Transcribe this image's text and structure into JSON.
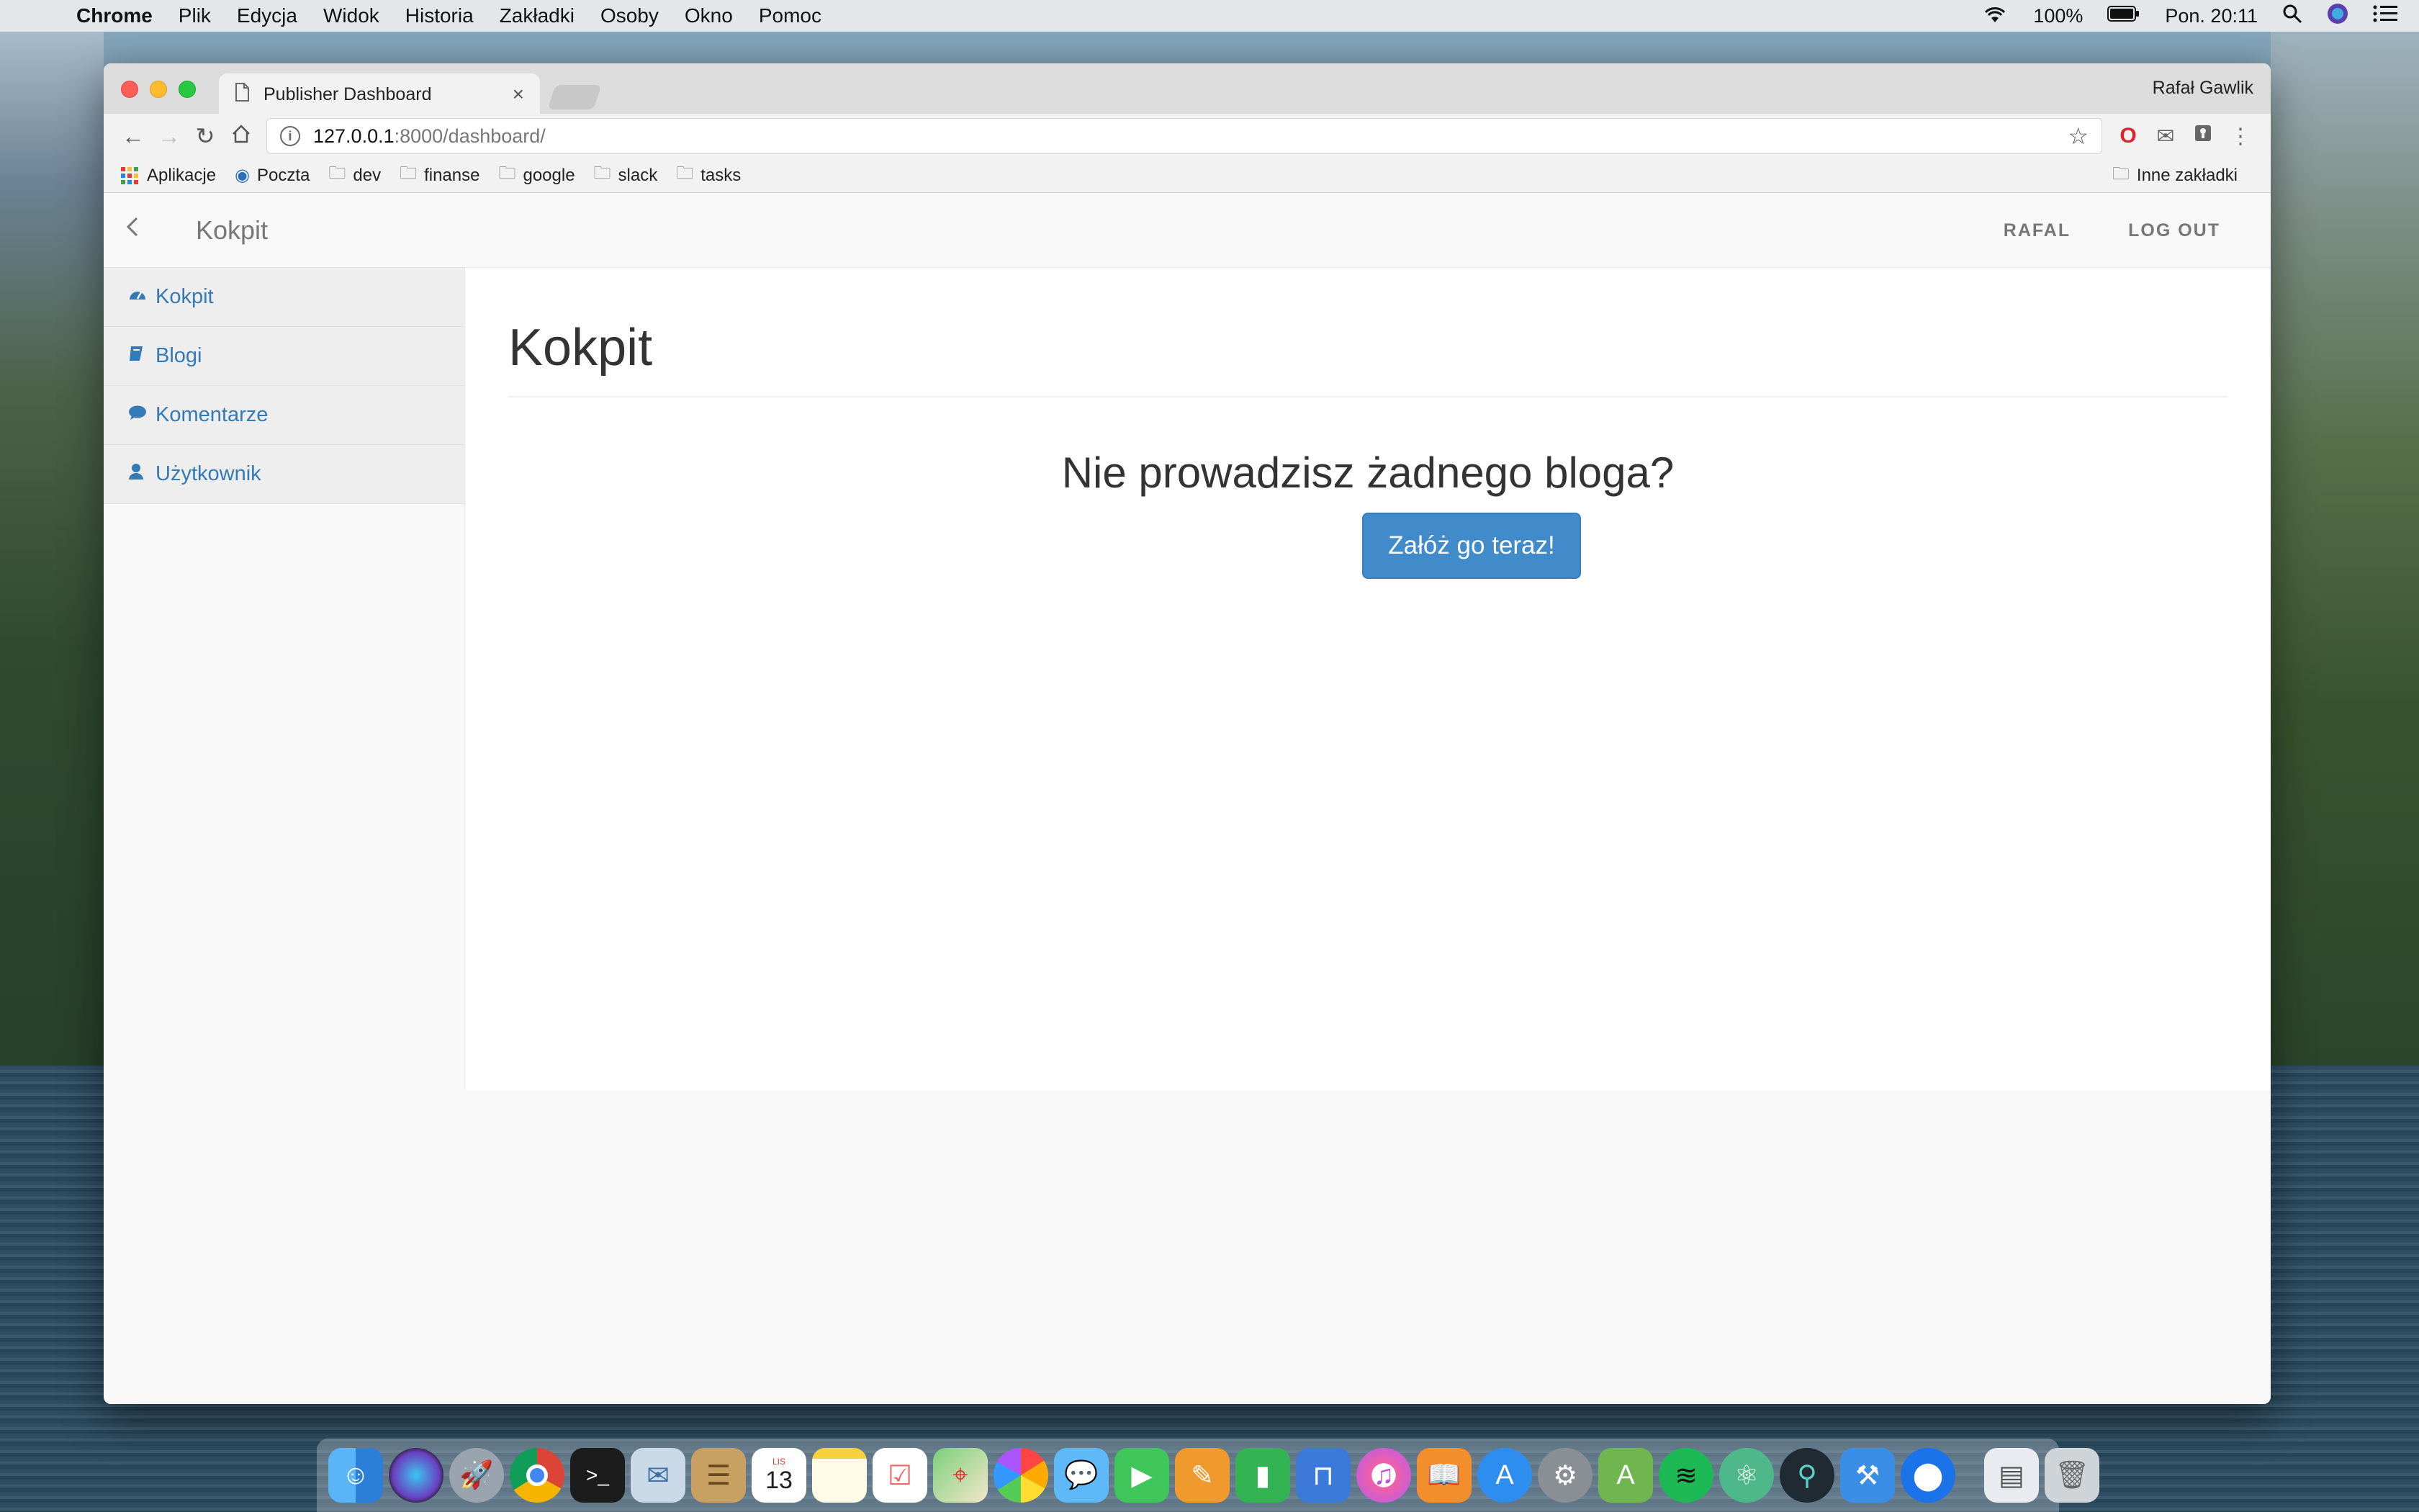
{
  "menubar": {
    "app": "Chrome",
    "items": [
      "Plik",
      "Edycja",
      "Widok",
      "Historia",
      "Zakładki",
      "Osoby",
      "Okno",
      "Pomoc"
    ],
    "battery": "100%",
    "clock": "Pon. 20:11"
  },
  "browser": {
    "tab_title": "Publisher Dashboard",
    "profile_name": "Rafał Gawlik",
    "url_host": "127.0.0.1",
    "url_path": ":8000/dashboard/",
    "bookmarks": [
      "Aplikacje",
      "Poczta",
      "dev",
      "finanse",
      "google",
      "slack",
      "tasks"
    ],
    "other_bookmarks": "Inne zakładki"
  },
  "page": {
    "brand": "Kokpit",
    "nav_user": "RAFAL",
    "nav_logout": "LOG OUT",
    "sidebar": [
      {
        "label": "Kokpit",
        "icon": "dashboard-icon"
      },
      {
        "label": "Blogi",
        "icon": "book-icon"
      },
      {
        "label": "Komentarze",
        "icon": "comment-icon"
      },
      {
        "label": "Użytkownik",
        "icon": "user-icon"
      }
    ],
    "heading": "Kokpit",
    "empty_message": "Nie prowadzisz żadnego bloga?",
    "cta_label": "Załóż go teraz!"
  },
  "dock": {
    "calendar_day": "13",
    "calendar_month": "LIS"
  }
}
